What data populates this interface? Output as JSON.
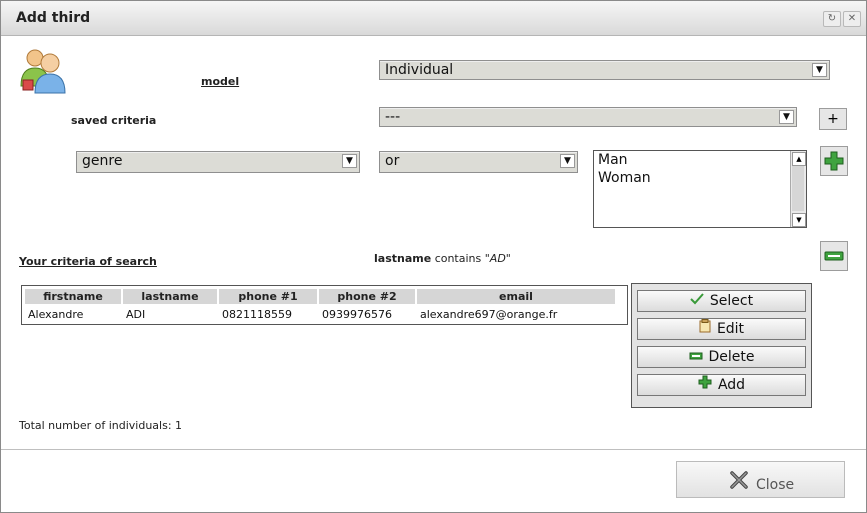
{
  "dialog": {
    "title": "Add third"
  },
  "form": {
    "model_label": "model",
    "model_value": "Individual",
    "saved_criteria_label": "saved criteria",
    "saved_criteria_value": "---",
    "add_saved_label": "+",
    "field_value": "genre",
    "operator_value": "or",
    "options": [
      "Man",
      "Woman"
    ]
  },
  "criteria": {
    "heading": "Your criteria of search",
    "field": "lastname",
    "operator": "contains",
    "value": "\"AD\""
  },
  "results": {
    "columns": [
      "firstname",
      "lastname",
      "phone #1",
      "phone #2",
      "email"
    ],
    "rows": [
      [
        "Alexandre",
        "ADI",
        "0821118559",
        "0939976576",
        "alexandre697@orange.fr"
      ]
    ],
    "total_label": "Total number of individuals: 1"
  },
  "actions": {
    "select": "Select",
    "edit": "Edit",
    "delete": "Delete",
    "add": "Add"
  },
  "footer": {
    "close": "Close"
  },
  "colors": {
    "accent_green": "#2e8b2e",
    "titlebar": "#e6e6e6"
  }
}
